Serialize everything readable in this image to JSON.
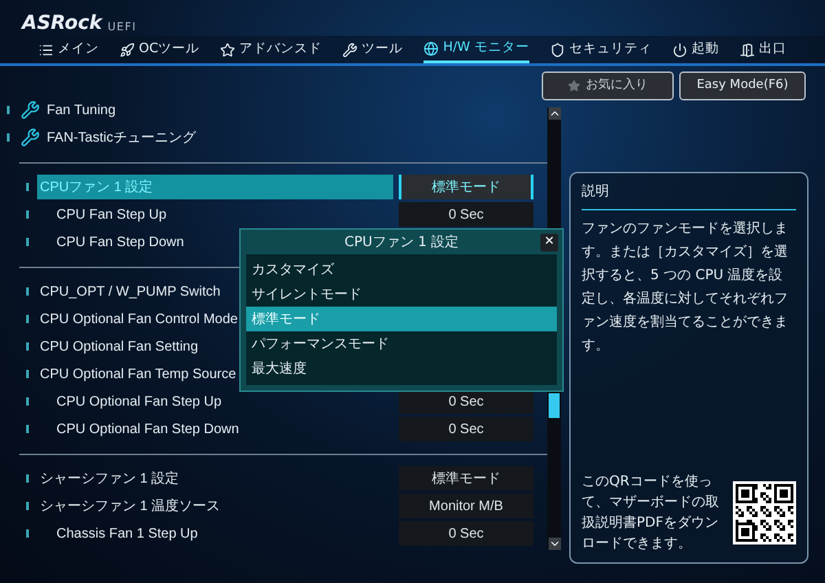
{
  "brand": {
    "name": "ASRock",
    "suffix": "UEFI"
  },
  "tabs": [
    {
      "label": "メイン",
      "selected": false
    },
    {
      "label": "OCツール",
      "selected": false
    },
    {
      "label": "アドバンスド",
      "selected": false
    },
    {
      "label": "ツール",
      "selected": false
    },
    {
      "label": "H/W モニター",
      "selected": true
    },
    {
      "label": "セキュリティ",
      "selected": false
    },
    {
      "label": "起動",
      "selected": false
    },
    {
      "label": "出口",
      "selected": false
    }
  ],
  "toolbar": {
    "favorites": "お気に入り",
    "easy_mode": "Easy Mode(F6)"
  },
  "sections": [
    {
      "items": [
        {
          "kind": "link",
          "label": "Fan Tuning",
          "selected": false
        },
        {
          "kind": "link",
          "label": "FAN-Tasticチューニング",
          "selected": false
        }
      ]
    },
    {
      "items": [
        {
          "kind": "setting",
          "label": "CPUファン 1 設定",
          "value": "標準モード",
          "selected": true,
          "children": [
            {
              "kind": "setting",
              "label": "CPU Fan Step Up",
              "value": "0 Sec",
              "selected": false
            },
            {
              "kind": "setting",
              "label": "CPU Fan Step Down",
              "selected": false
            }
          ]
        }
      ]
    },
    {
      "items": [
        {
          "kind": "setting",
          "label": "CPU_OPT / W_PUMP Switch",
          "selected": false
        },
        {
          "kind": "setting",
          "label": "CPU Optional Fan Control Mode",
          "selected": false
        },
        {
          "kind": "setting",
          "label": "CPU Optional Fan Setting",
          "selected": false
        },
        {
          "kind": "setting",
          "label": "CPU Optional Fan Temp Source",
          "selected": false,
          "children": [
            {
              "kind": "setting",
              "label": "CPU Optional Fan Step Up",
              "value": "0 Sec",
              "selected": false
            },
            {
              "kind": "setting",
              "label": "CPU Optional Fan Step Down",
              "value": "0 Sec",
              "selected": false
            }
          ]
        }
      ]
    },
    {
      "items": [
        {
          "kind": "setting",
          "label": "シャーシファン 1 設定",
          "value": "標準モード",
          "selected": false
        },
        {
          "kind": "setting",
          "label": "シャーシファン 1 温度ソース",
          "value": "Monitor M/B",
          "selected": false,
          "children": [
            {
              "kind": "setting",
              "label": "Chassis Fan 1 Step Up",
              "value": "0 Sec",
              "selected": false
            }
          ]
        }
      ]
    }
  ],
  "dialog": {
    "title": "CPUファン 1 設定",
    "close": "✕",
    "options": [
      {
        "label": "カスタマイズ",
        "selected": false
      },
      {
        "label": "サイレントモード",
        "selected": false
      },
      {
        "label": "標準モード",
        "selected": true
      },
      {
        "label": "パフォーマンスモード",
        "selected": false
      },
      {
        "label": "最大速度",
        "selected": false
      }
    ]
  },
  "description": {
    "title": "説明",
    "text": "ファンのファンモードを選択します。または［カスタマイズ］を選択すると、5 つの CPU 温度を設定し、各温度に対してそれぞれファン速度を割当てることができます。",
    "qr_text": "このQRコードを使って、マザーボードの取扱説明書PDFをダウンロードできます。"
  }
}
